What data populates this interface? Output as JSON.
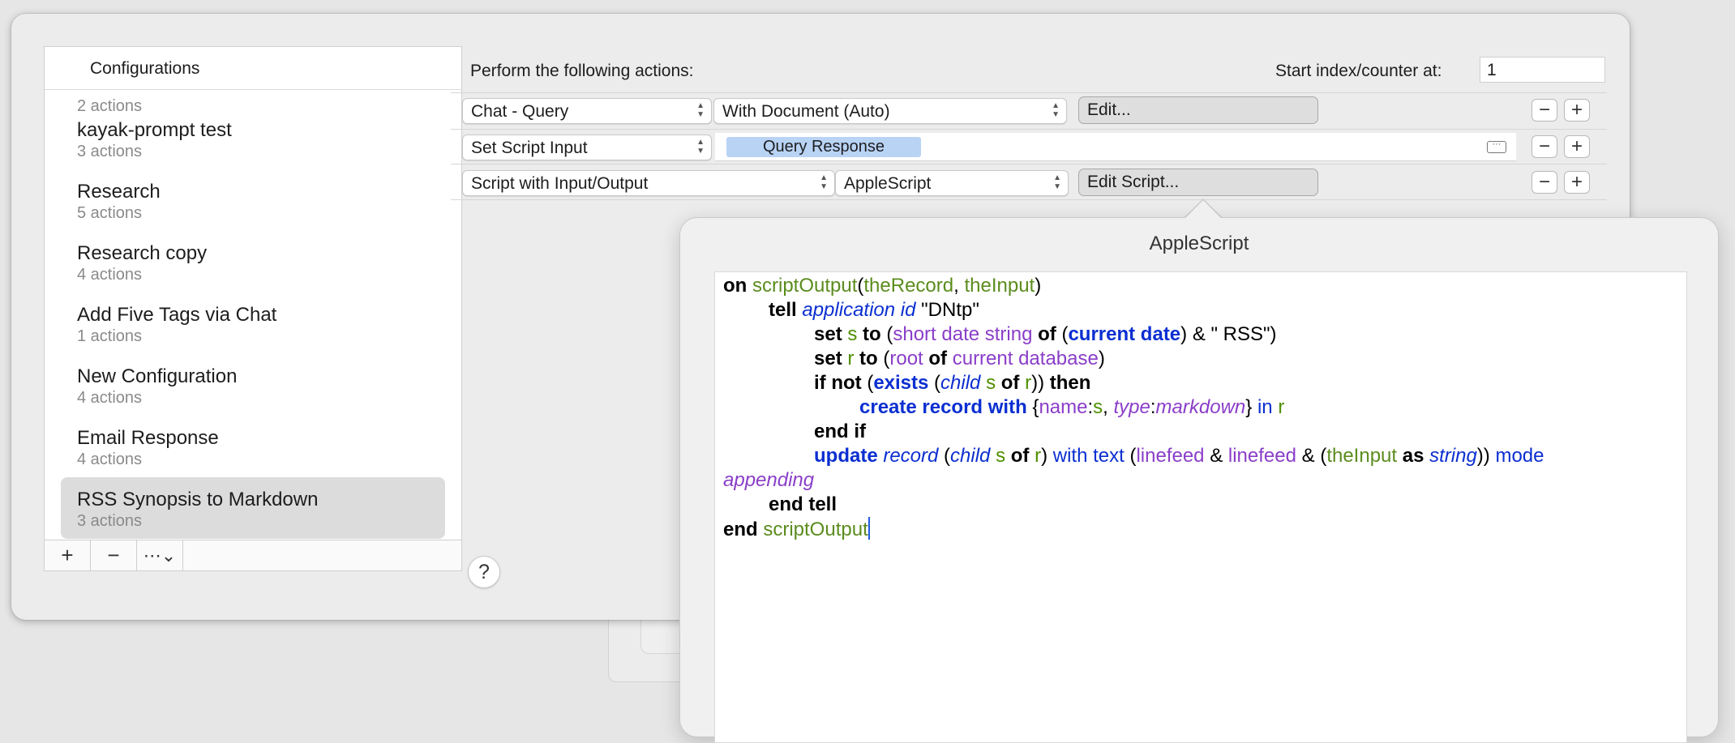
{
  "sidebar": {
    "header": "Configurations",
    "items": [
      {
        "name": "",
        "sub": "2 actions"
      },
      {
        "name": "kayak-prompt test",
        "sub": "3 actions"
      },
      {
        "name": "Research",
        "sub": "5 actions"
      },
      {
        "name": "Research copy",
        "sub": "4 actions"
      },
      {
        "name": "Add Five Tags via Chat",
        "sub": "1 actions"
      },
      {
        "name": "New Configuration",
        "sub": "4 actions"
      },
      {
        "name": "Email Response",
        "sub": "4 actions"
      },
      {
        "name": "RSS Synopsis to Markdown",
        "sub": "3 actions",
        "selected": true
      }
    ],
    "footer": {
      "add": "+",
      "remove": "−",
      "more": "⋯⌄"
    }
  },
  "actions": {
    "perform_label": "Perform the following actions:",
    "start_label": "Start index/counter at:",
    "start_value": "1",
    "rows": [
      {
        "action": "Chat - Query",
        "option": "With Document (Auto)",
        "button": "Edit..."
      },
      {
        "action": "Set Script Input",
        "token": "Query Response"
      },
      {
        "action": "Script with Input/Output",
        "option": "AppleScript",
        "button": "Edit Script..."
      }
    ],
    "minus": "−",
    "plus": "+",
    "help": "?"
  },
  "popover": {
    "title": "AppleScript"
  },
  "code": {
    "l1": [
      "on",
      "scriptOutput",
      "(",
      "theRecord",
      ", ",
      "theInput",
      ")"
    ],
    "l2": [
      "tell",
      "application",
      "id",
      "\"DNtp\""
    ],
    "l3": [
      "set",
      "s",
      "to",
      "(",
      "short date string",
      "of",
      "(",
      "current date",
      ") & \" RSS\")"
    ],
    "l4": [
      "set",
      "r",
      "to",
      "(",
      "root",
      "of",
      "current database",
      ")"
    ],
    "l5": [
      "if not",
      "(",
      "exists",
      "(",
      "child",
      "s",
      "of",
      "r",
      "))",
      "then"
    ],
    "l6": [
      "create record with",
      "{",
      "name",
      ":",
      "s",
      ", ",
      "type",
      ":",
      "markdown",
      "}",
      "in",
      "r"
    ],
    "l7": [
      "end if"
    ],
    "l8": [
      "update",
      "record",
      "(",
      "child",
      "s",
      "of",
      "r",
      ")",
      "with text",
      "(",
      "linefeed",
      "&",
      "linefeed",
      "& (",
      "theInput",
      "as",
      "string",
      "))",
      "mode"
    ],
    "l9": [
      "appending"
    ],
    "l10": [
      "end tell"
    ],
    "l11": [
      "end",
      "scriptOutput"
    ]
  },
  "colors": {
    "keyword": "#000000",
    "applescript_keyword": "#0b2fd1",
    "handler": "#5b8c1e",
    "variable": "#4f8f00",
    "property": "#8a3ec8",
    "token_bg": "#b9d3f5",
    "selection_bg": "#dcdcdc"
  }
}
